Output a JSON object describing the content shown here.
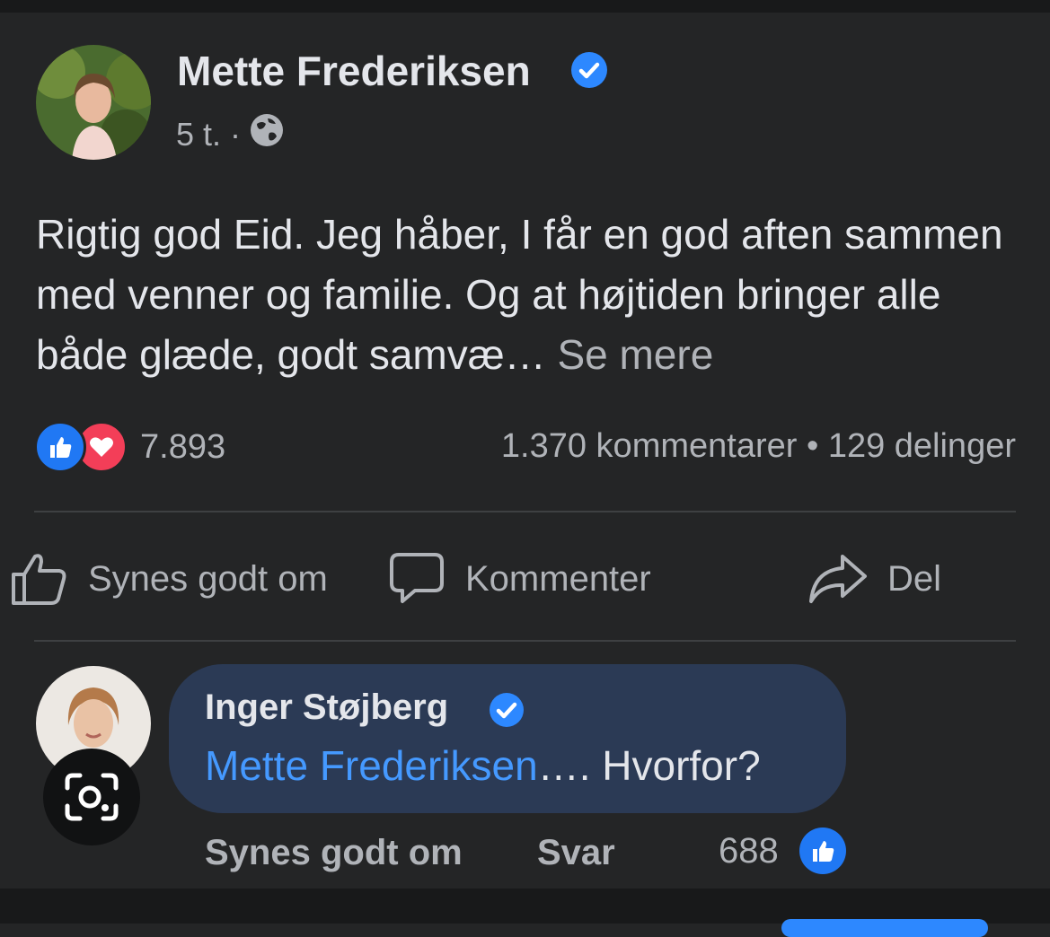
{
  "post": {
    "author": "Mette Frederiksen",
    "time": "5 t.",
    "separator": "·",
    "privacy_icon": "globe-icon",
    "text_main": "Rigtig god Eid. Jeg håber, I får en god aften sammen med venner og familie. Og at højtiden bringer alle både glæde, godt samvæ…",
    "see_more": "Se mere",
    "reaction_icons": [
      "like-reaction-icon",
      "love-reaction-icon"
    ],
    "reaction_count": "7.893",
    "stats": "1.370 kommentarer • 129 delinger"
  },
  "actions": {
    "like": "Synes godt om",
    "comment": "Kommenter",
    "share": "Del"
  },
  "comment": {
    "author": "Inger Støjberg",
    "mention": "Mette Frederiksen",
    "text": "…. Hvorfor?",
    "like_label": "Synes godt om",
    "reply_label": "Svar",
    "like_count": "688"
  },
  "colors": {
    "background": "#242526",
    "accent": "#2d88ff",
    "love": "#f33e58",
    "bubble": "#2b3a55",
    "mention": "#4599ff"
  }
}
